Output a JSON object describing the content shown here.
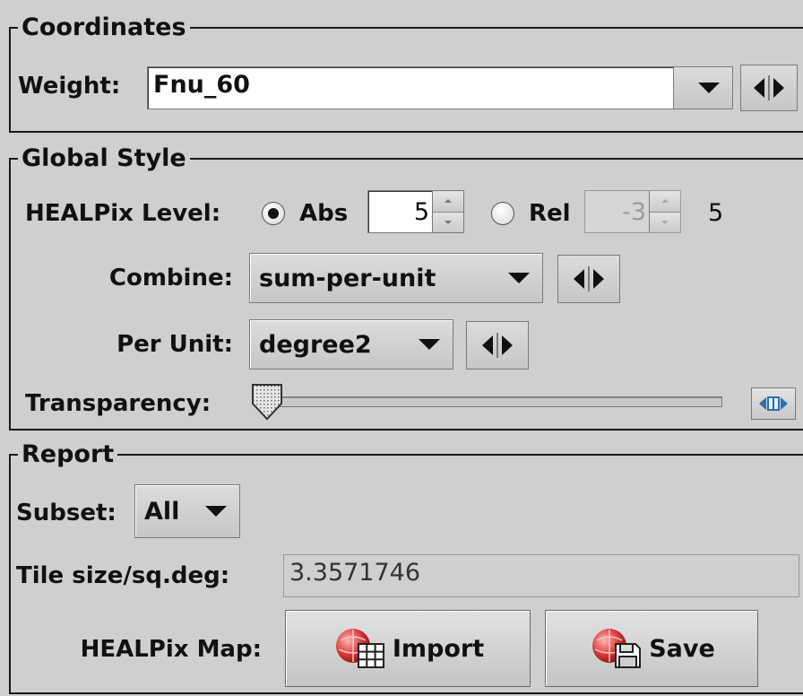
{
  "coordinates": {
    "title": "Coordinates",
    "weight_label": "Weight:",
    "weight_value": "Fnu_60"
  },
  "global_style": {
    "title": "Global Style",
    "healpix_level_label": "HEALPix Level:",
    "abs_label": "Abs",
    "abs_value": "5",
    "abs_selected": true,
    "rel_label": "Rel",
    "rel_value": "-3",
    "level_readout": "5",
    "combine_label": "Combine:",
    "combine_value": "sum-per-unit",
    "per_unit_label": "Per Unit:",
    "per_unit_value": "degree2",
    "transparency_label": "Transparency:",
    "transparency_level": 0
  },
  "report": {
    "title": "Report",
    "subset_label": "Subset:",
    "subset_value": "All",
    "tile_size_label": "Tile size/sq.deg:",
    "tile_size_value": "3.3571746",
    "healpix_map_label": "HEALPix Map:",
    "import_label": "Import",
    "save_label": "Save"
  },
  "icons": {
    "combo_arrow": "chevron-down-icon",
    "cycle_prev": "triangle-left-icon",
    "cycle_next": "triangle-right-icon",
    "expand": "expand-horizontal-icon",
    "import": "healpix-import-icon",
    "save": "healpix-save-icon"
  }
}
